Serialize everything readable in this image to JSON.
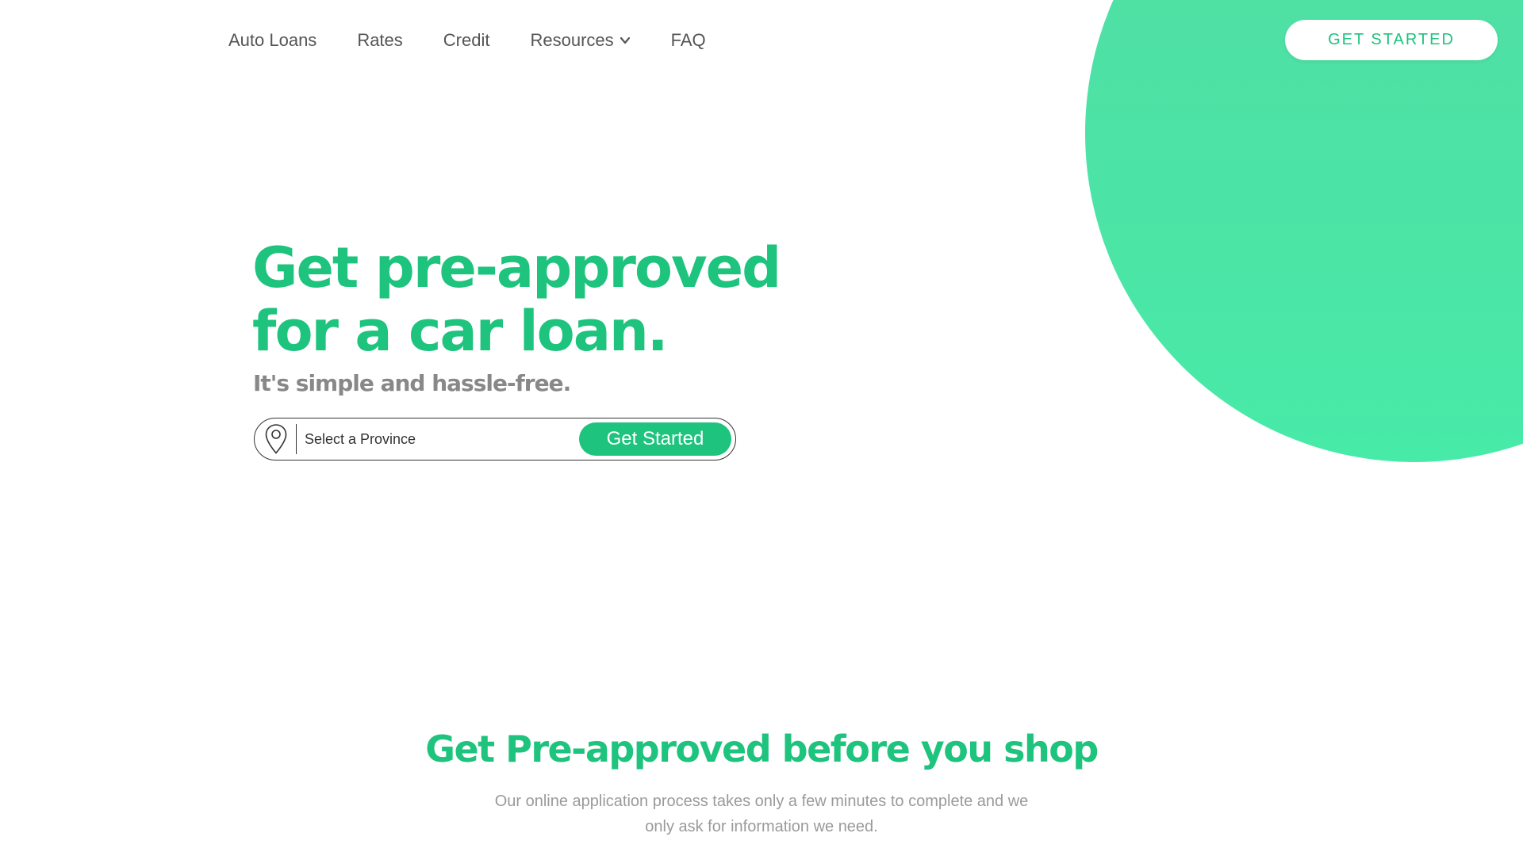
{
  "nav": {
    "items": [
      {
        "label": "Auto Loans"
      },
      {
        "label": "Rates"
      },
      {
        "label": "Credit"
      },
      {
        "label": "Resources",
        "has_dropdown": true
      },
      {
        "label": "FAQ"
      }
    ],
    "cta_label": "GET STARTED"
  },
  "hero": {
    "title_line1": "Get pre-approved",
    "title_line2": "for a car loan.",
    "subtitle": "It's simple and hassle-free.",
    "form": {
      "select_placeholder": "Select a Province",
      "button_label": "Get Started"
    }
  },
  "section": {
    "title": "Get Pre-approved before you shop",
    "body_line1": "Our online application process takes only a few minutes to complete and we",
    "body_line2": "only ask for information we need."
  },
  "colors": {
    "brand_green": "#1ec37e",
    "blob_green": "#4de2a6",
    "muted_text": "#888888"
  },
  "icons": [
    "chevron-down-icon",
    "location-pin-icon"
  ]
}
